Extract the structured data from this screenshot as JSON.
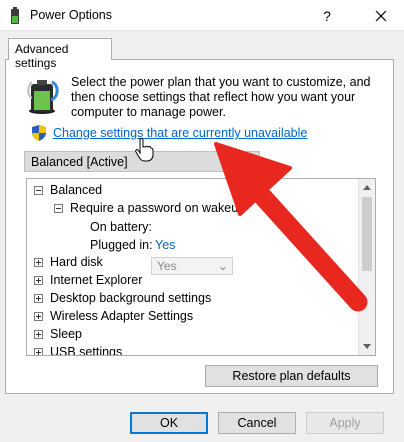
{
  "window": {
    "title": "Power Options"
  },
  "tabs": [
    {
      "label": "Advanced settings"
    }
  ],
  "intro_text": "Select the power plan that you want to customize, and then choose settings that reflect how you want your computer to manage power.",
  "change_link": "Change settings that are currently unavailable",
  "plan_select": {
    "value": "Balanced [Active]"
  },
  "tree": {
    "balanced": "Balanced",
    "password": "Require a password on wakeup",
    "on_battery_label": "On battery:",
    "on_battery_value": "Yes",
    "plugged_in_label": "Plugged in:",
    "plugged_in_value": "Yes",
    "items": [
      "Hard disk",
      "Internet Explorer",
      "Desktop background settings",
      "Wireless Adapter Settings",
      "Sleep",
      "USB settings"
    ]
  },
  "buttons": {
    "restore": "Restore plan defaults",
    "ok": "OK",
    "cancel": "Cancel",
    "apply": "Apply"
  },
  "colors": {
    "link": "#0066cc",
    "annotation_arrow": "#e8281f",
    "ok_border": "#0078d7"
  }
}
